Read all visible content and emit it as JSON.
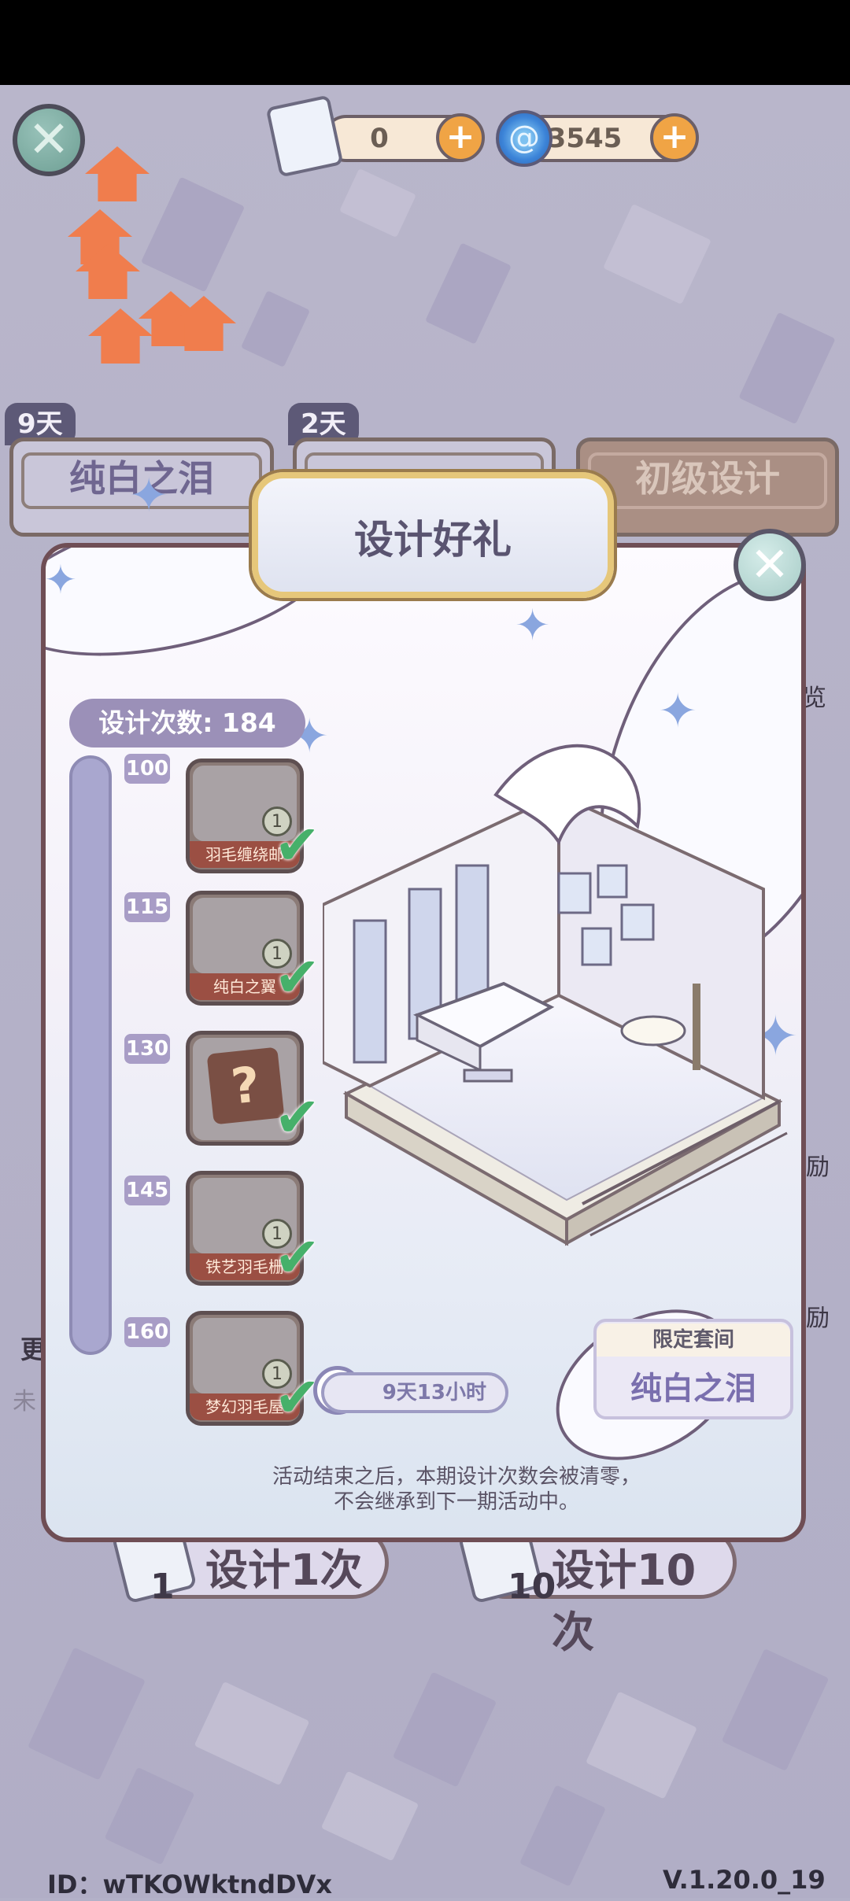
{
  "hud": {
    "ticket_count": "0",
    "currency_count": "3545",
    "plus_symbol": "+",
    "close_symbol": "✕"
  },
  "tabs": [
    {
      "days": "9天",
      "label": "纯白之泪"
    },
    {
      "days": "2天",
      "label": ""
    },
    {
      "days": "",
      "label": "初级设计"
    }
  ],
  "modal": {
    "title": "设计好礼",
    "close_symbol": "✕",
    "design_count": "设计次数: 184",
    "milestones": [
      {
        "threshold": "100",
        "name": "羽毛缠绕邮",
        "qty": "1",
        "claimed": true
      },
      {
        "threshold": "115",
        "name": "纯白之翼",
        "qty": "1",
        "claimed": true
      },
      {
        "threshold": "130",
        "name": "",
        "qty": "",
        "claimed": true,
        "mystery": "?"
      },
      {
        "threshold": "145",
        "name": "铁艺羽毛栅",
        "qty": "1",
        "claimed": true
      },
      {
        "threshold": "160",
        "name": "梦幻羽毛屋",
        "qty": "1",
        "claimed": true
      }
    ],
    "timer": "9天13小时",
    "suite_caption": "限定套间",
    "suite_name": "纯白之泪",
    "note_line1": "活动结束之后，本期设计次数会被清零，",
    "note_line2": "不会继承到下一期活动中。"
  },
  "bottom": {
    "design_once": "设计1次",
    "design_once_cost": "1",
    "design_ten": "设计10次",
    "design_ten_cost": "10"
  },
  "side": {
    "right1": "励",
    "right2": "励",
    "right3": "览",
    "left1": "更",
    "left2": "未"
  },
  "footer": {
    "id": "ID：wTKOWktndDVx",
    "version": "V.1.20.0_19"
  },
  "colors": {
    "accent": "#f07d4d",
    "modal_border": "#6f4e55",
    "check": "#46b06a",
    "purple": "#9b90b8"
  }
}
